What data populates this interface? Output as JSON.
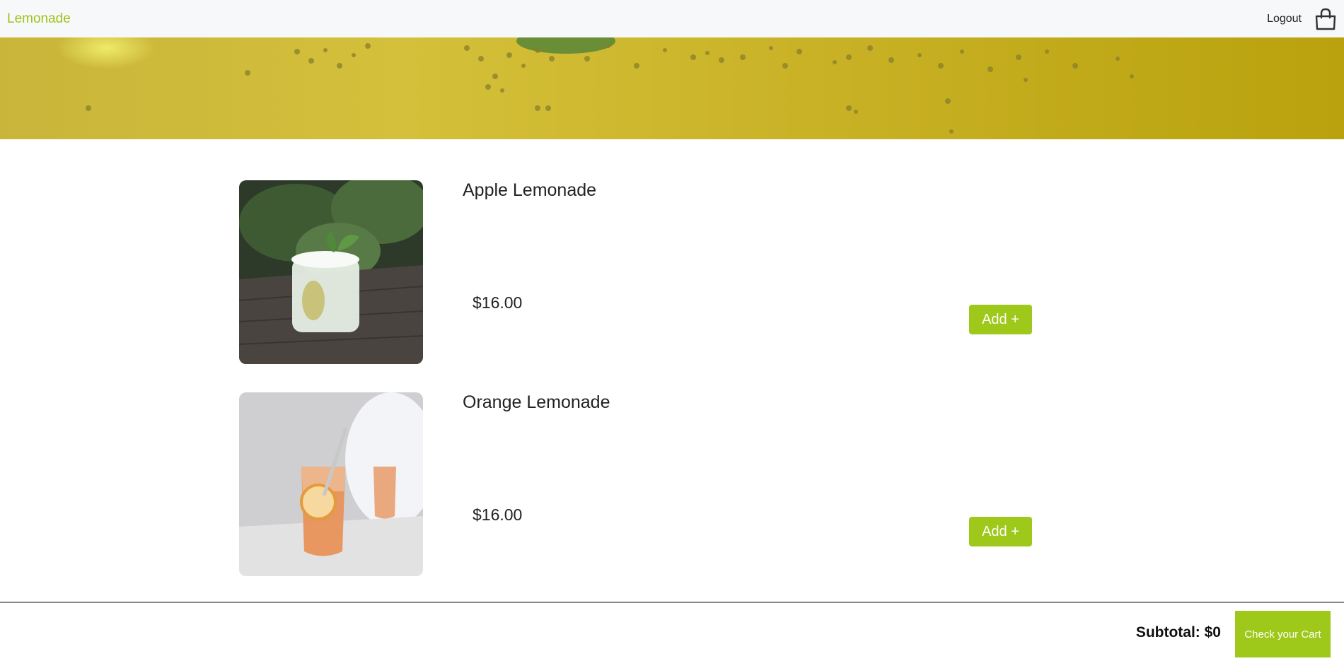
{
  "navbar": {
    "brand": "Lemonade",
    "logout_label": "Logout",
    "cart_icon": "shopping-bag-icon"
  },
  "products": [
    {
      "name": "Apple Lemonade",
      "price": "$16.00",
      "add_label": "Add +"
    },
    {
      "name": "Orange Lemonade",
      "price": "$16.00",
      "add_label": "Add +"
    }
  ],
  "footer": {
    "subtotal": "Subtotal: $0",
    "checkout_label": "Check your Cart"
  },
  "colors": {
    "accent": "#9ec81a",
    "brand": "#9ec11b",
    "navbar_bg": "#f7f8f9",
    "hero": "#c9b53a"
  }
}
